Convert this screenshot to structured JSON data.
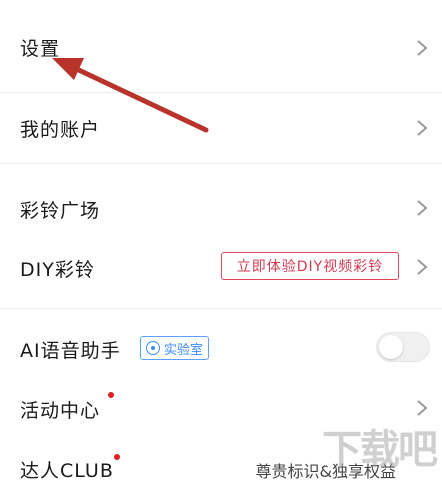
{
  "menu": {
    "settings_label": "设置",
    "account_label": "我的账户",
    "ringtone_plaza_label": "彩铃广场",
    "diy_ringtone_label": "DIY彩铃",
    "diy_promo_text": "立即体验DIY视频彩铃",
    "ai_assistant_label": "AI语音助手",
    "lab_badge_text": "实验室",
    "activity_center_label": "活动中心",
    "club_label": "达人CLUB",
    "club_side_text": "尊贵标识&独享权益"
  },
  "ai_assistant_toggle": {
    "enabled": false
  },
  "watermark": {
    "text": "下载吧"
  },
  "colors": {
    "promo_red": "#d23a52",
    "badge_blue": "#3b8cff",
    "notification_dot": "#e02020",
    "annotation_arrow": "#b8332a"
  },
  "icons": {
    "chevron": "chevron-right-icon",
    "lab": "lab-icon",
    "annotation": "red-arrow-annotation"
  }
}
